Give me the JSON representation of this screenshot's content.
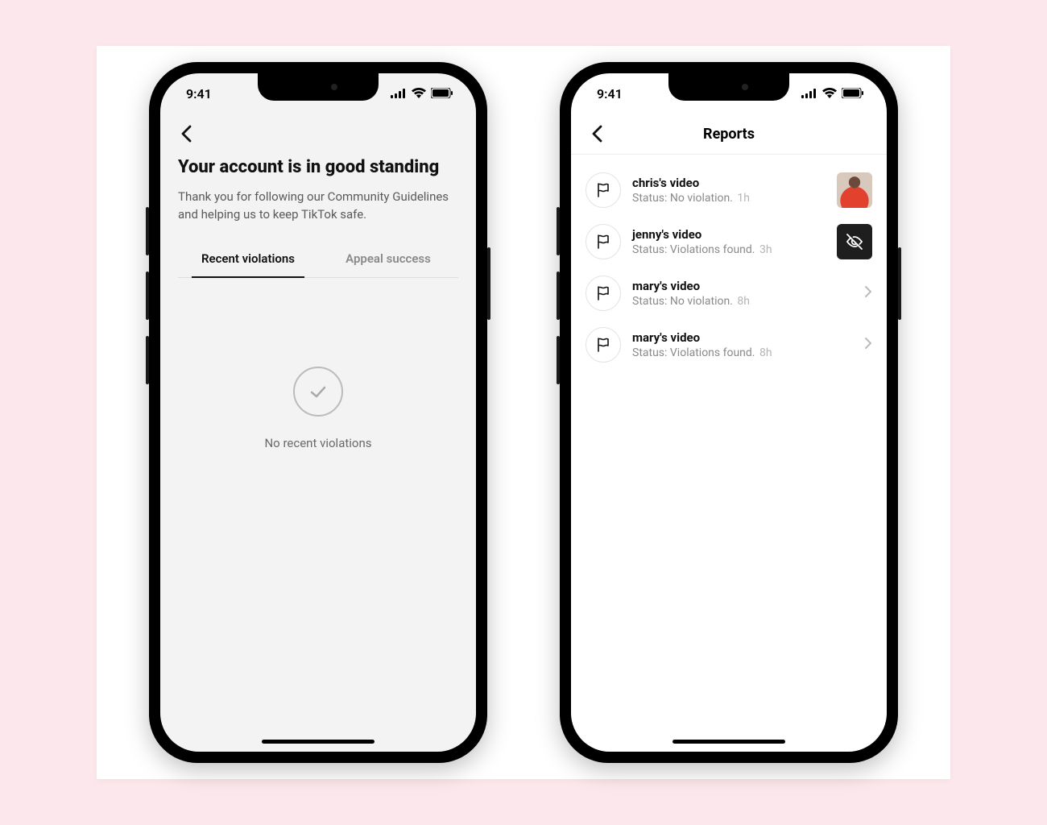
{
  "status_time": "9:41",
  "left": {
    "title": "Your account is in good standing",
    "subtitle": "Thank you for following our Community Guidelines and helping us to keep TikTok safe.",
    "tabs": [
      "Recent violations",
      "Appeal success"
    ],
    "empty_text": "No recent violations"
  },
  "right": {
    "header_title": "Reports",
    "items": [
      {
        "title": "chris's video",
        "status": "Status: No violation.",
        "time": "1h",
        "trailing": "thumb_person"
      },
      {
        "title": "jenny's video",
        "status": "Status: Violations found.",
        "time": "3h",
        "trailing": "thumb_hidden"
      },
      {
        "title": "mary's video",
        "status": "Status: No violation.",
        "time": "8h",
        "trailing": "chevron"
      },
      {
        "title": "mary's video",
        "status": "Status: Violations found.",
        "time": "8h",
        "trailing": "chevron"
      }
    ]
  }
}
